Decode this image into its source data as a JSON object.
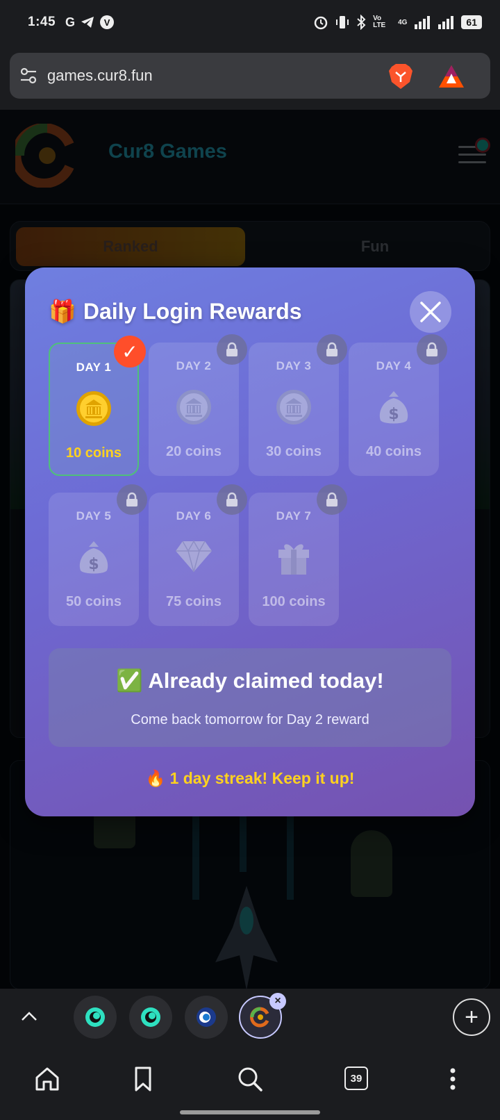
{
  "status_bar": {
    "time": "1:45",
    "left_icons": [
      "G",
      "telegram-icon",
      "V"
    ],
    "network": "4G",
    "volte": "Vo LTE",
    "battery": "61"
  },
  "browser": {
    "url": "games.cur8.fun",
    "tab_count": "39"
  },
  "site": {
    "title": "Cur8 Games",
    "tabs": [
      "Ranked",
      "Fun"
    ]
  },
  "modal": {
    "title_emoji": "🎁",
    "title": "Daily Login Rewards",
    "days": [
      {
        "label": "DAY 1",
        "reward": "10 coins",
        "icon": "gold-coin-icon",
        "state": "claimed"
      },
      {
        "label": "DAY 2",
        "reward": "20 coins",
        "icon": "silver-coin-icon",
        "state": "locked"
      },
      {
        "label": "DAY 3",
        "reward": "30 coins",
        "icon": "silver-coin-icon",
        "state": "locked"
      },
      {
        "label": "DAY 4",
        "reward": "40 coins",
        "icon": "money-bag-icon",
        "state": "locked"
      },
      {
        "label": "DAY 5",
        "reward": "50 coins",
        "icon": "money-bag-icon",
        "state": "locked"
      },
      {
        "label": "DAY 6",
        "reward": "75 coins",
        "icon": "diamond-icon",
        "state": "locked"
      },
      {
        "label": "DAY 7",
        "reward": "100 coins",
        "icon": "gift-icon",
        "state": "locked"
      }
    ],
    "claimed_title": "✅ Already claimed today!",
    "claimed_sub": "Come back tomorrow for Day 2 reward",
    "streak": "🔥 1 day streak! Keep it up!",
    "check_mark": "✓"
  },
  "colors": {
    "accent_gold": "#ffd21f",
    "claimed_border": "#4fc07a",
    "check_badge": "#ff4e2a"
  }
}
